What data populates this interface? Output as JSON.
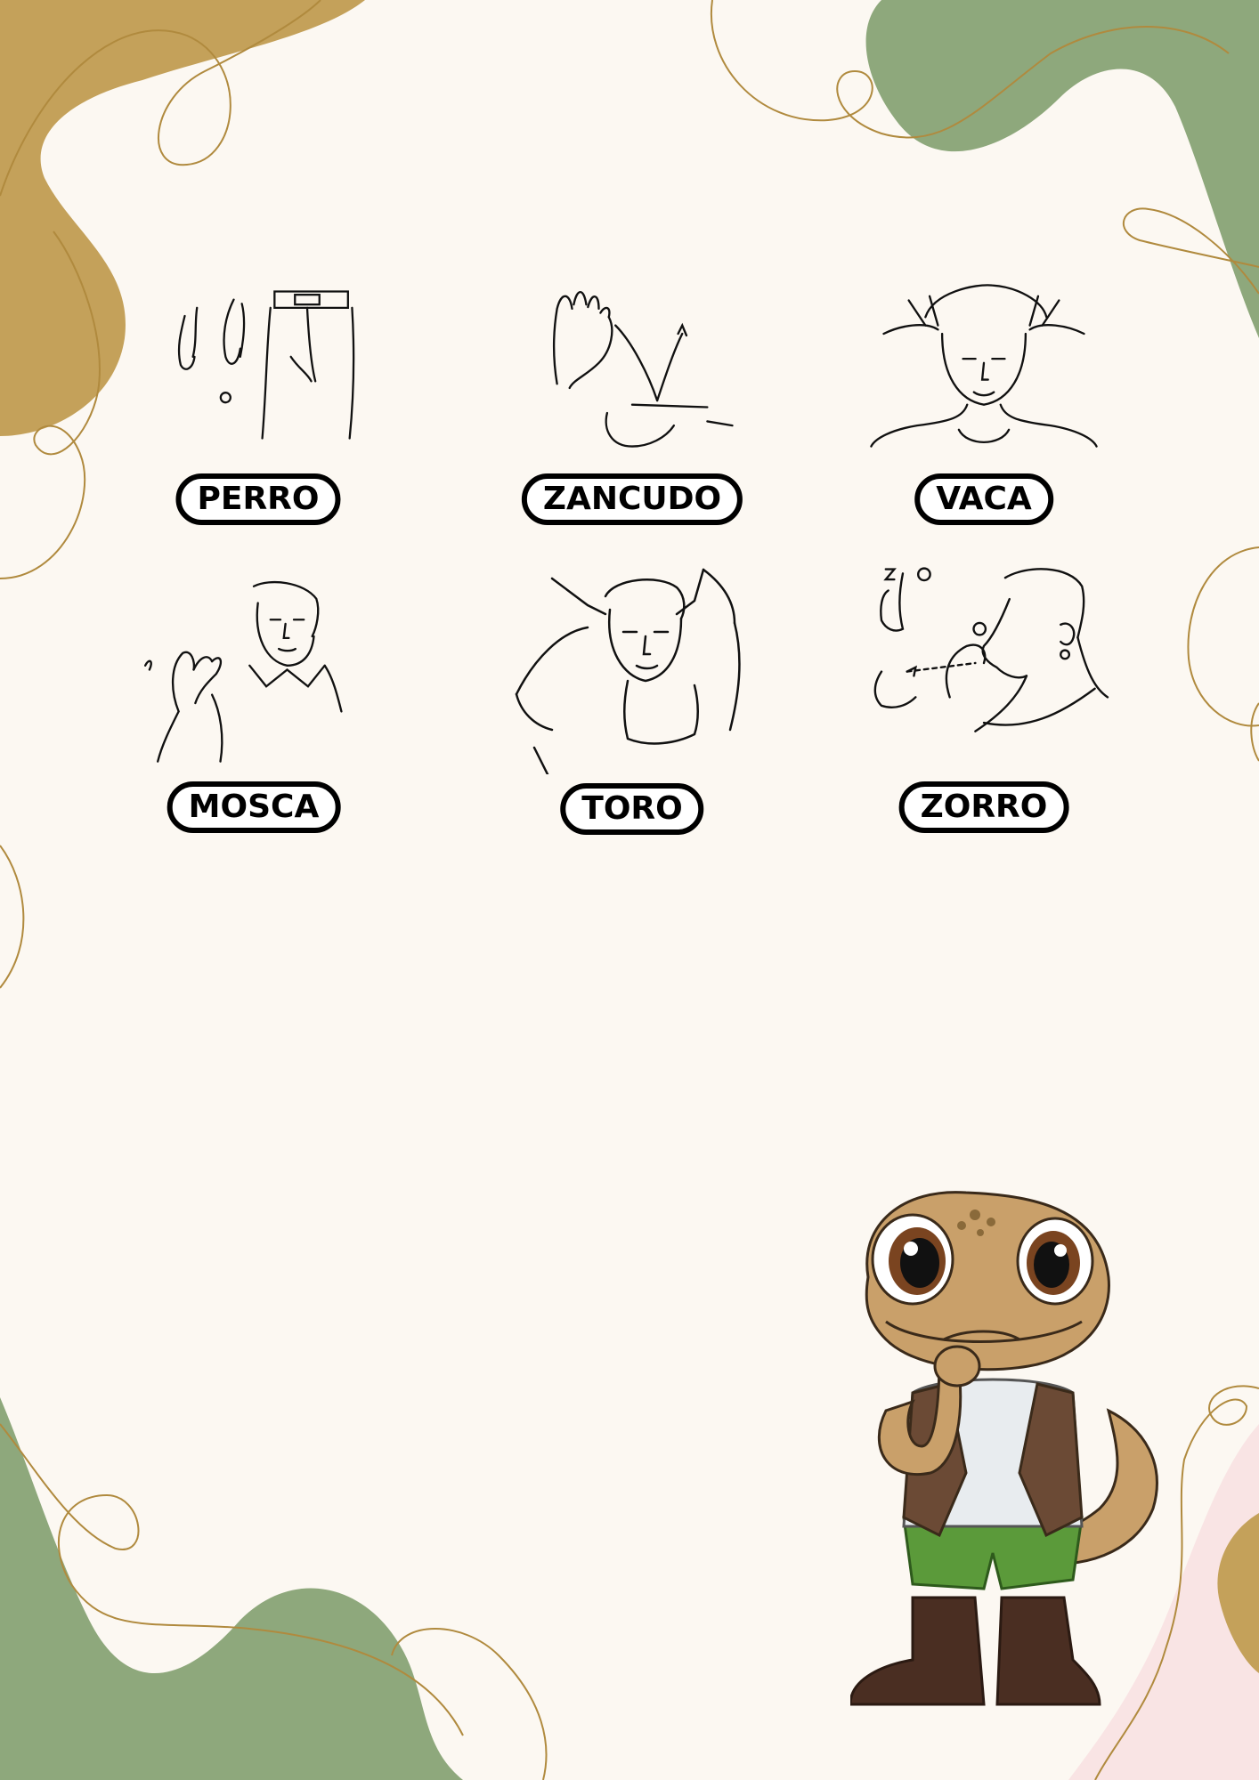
{
  "page": {
    "colors": {
      "background": "#fcf8f2",
      "mustard": "#c4a15a",
      "sage": "#8ea87c",
      "pink": "#f9e4e4",
      "line": "#b08a3e"
    }
  },
  "signs": [
    {
      "label": "PERRO",
      "icon": "sign-perro-illustration"
    },
    {
      "label": "ZANCUDO",
      "icon": "sign-zancudo-illustration"
    },
    {
      "label": "VACA",
      "icon": "sign-vaca-illustration"
    },
    {
      "label": "MOSCA",
      "icon": "sign-mosca-illustration"
    },
    {
      "label": "TORO",
      "icon": "sign-toro-illustration"
    },
    {
      "label": "ZORRO",
      "icon": "sign-zorro-illustration"
    }
  ],
  "mascot": {
    "icon": "lizard-mascot-illustration"
  }
}
